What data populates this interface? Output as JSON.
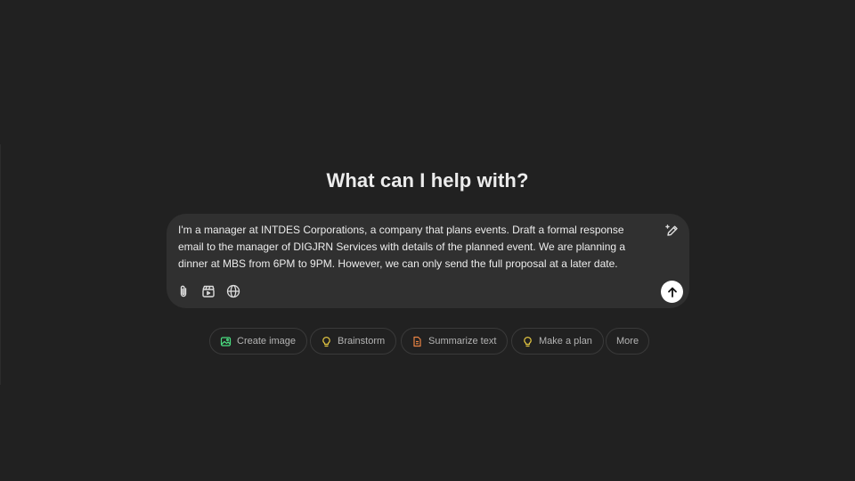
{
  "main": {
    "heading": "What can I help with?"
  },
  "composer": {
    "prompt": "I'm a manager at INTDES Corporations, a company that plans events. Draft a formal response email to the manager of DIGJRN Services with details of the planned event. We are planning a dinner at MBS from 6PM to 9PM. However, we can only send the full proposal at a later date.",
    "tools": [
      "paperclip-icon",
      "clapperboard-icon",
      "globe-icon"
    ],
    "send_icon": "arrow-up-icon",
    "edit_icon": "pencil-sparkle-icon"
  },
  "chips": {
    "items": [
      {
        "label": "Create image",
        "icon": "image-icon",
        "color": "#4ade80"
      },
      {
        "label": "Brainstorm",
        "icon": "lightbulb-icon",
        "color": "#e2c541"
      },
      {
        "label": "Summarize text",
        "icon": "document-icon",
        "color": "#ea8444"
      },
      {
        "label": "Make a plan",
        "icon": "lightbulb-icon",
        "color": "#e2c541"
      },
      {
        "label": "More",
        "icon": "",
        "color": ""
      }
    ]
  },
  "colors": {
    "background": "#212121",
    "composer": "#303030",
    "chip_border": "#3a3a3a",
    "text": "#ececec",
    "muted": "#b4b4b4"
  }
}
